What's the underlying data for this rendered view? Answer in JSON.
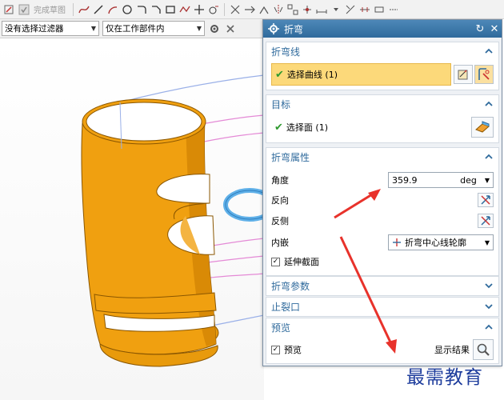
{
  "toolbar": {
    "finish_sketch_label": "完成草图"
  },
  "filter_bar": {
    "type_filter": "没有选择过滤器",
    "scope_filter": "仅在工作部件内"
  },
  "dialog": {
    "title": "折弯",
    "sections": {
      "bend_line": {
        "title": "折弯线",
        "select_label": "选择曲线 (1)"
      },
      "target": {
        "title": "目标",
        "select_label": "选择面 (1)"
      },
      "bend_props": {
        "title": "折弯属性",
        "angle_label": "角度",
        "angle_value": "359.9",
        "angle_unit": "deg",
        "reverse_label": "反向",
        "reverse_side_label": "反侧",
        "inset_label": "内嵌",
        "inset_value": "折弯中心线轮廓",
        "extend_label": "延伸截面",
        "extend_checked": true
      },
      "bend_params": {
        "title": "折弯参数"
      },
      "relief": {
        "title": "止裂口"
      },
      "preview": {
        "title": "预览",
        "preview_label": "预览",
        "preview_checked": true,
        "show_result_label": "显示结果"
      }
    }
  },
  "watermark": "最需教育",
  "colors": {
    "accent": "#2f6a9c",
    "selection": "#fcd97a",
    "part": "#f0a010",
    "arrow": "#e8322b"
  }
}
